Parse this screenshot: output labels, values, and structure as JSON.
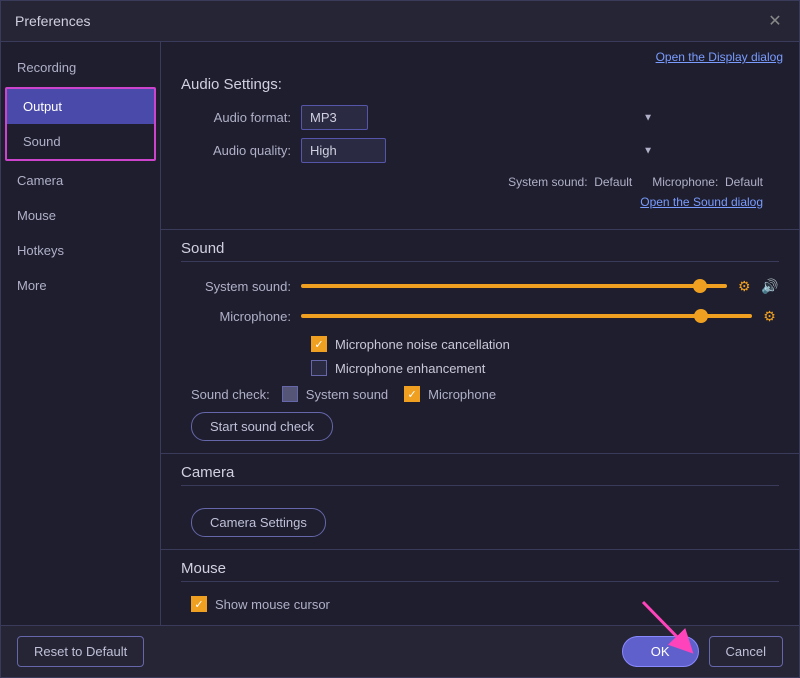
{
  "window": {
    "title": "Preferences",
    "close_label": "✕"
  },
  "sidebar": {
    "items": [
      {
        "id": "recording",
        "label": "Recording",
        "active": false,
        "outlined": false
      },
      {
        "id": "output",
        "label": "Output",
        "active": true,
        "outlined": true
      },
      {
        "id": "sound",
        "label": "Sound",
        "active": false,
        "outlined": true
      },
      {
        "id": "camera",
        "label": "Camera",
        "active": false,
        "outlined": false
      },
      {
        "id": "mouse",
        "label": "Mouse",
        "active": false,
        "outlined": false
      },
      {
        "id": "hotkeys",
        "label": "Hotkeys",
        "active": false,
        "outlined": false
      },
      {
        "id": "more",
        "label": "More",
        "active": false,
        "outlined": false
      }
    ]
  },
  "top_link": "Open the Display dialog",
  "audio_settings": {
    "title": "Audio Settings:",
    "format_label": "Audio format:",
    "format_value": "MP3",
    "quality_label": "Audio quality:",
    "quality_value": "High",
    "system_sound_label": "System sound:",
    "system_sound_value": "Default",
    "microphone_label": "Microphone:",
    "microphone_value": "Default",
    "open_sound_link": "Open the Sound dialog"
  },
  "sound_section": {
    "title": "Sound",
    "system_sound_label": "System sound:",
    "microphone_label": "Microphone:",
    "noise_cancellation_label": "Microphone noise cancellation",
    "enhancement_label": "Microphone enhancement",
    "noise_cancellation_checked": true,
    "enhancement_checked": false,
    "sound_check_label": "Sound check:",
    "system_sound_check_checked": false,
    "microphone_check_checked": true,
    "system_sound_check_label": "System sound",
    "microphone_check_label": "Microphone",
    "start_check_btn": "Start sound check"
  },
  "camera_section": {
    "title": "Camera",
    "settings_btn": "Camera Settings"
  },
  "mouse_section": {
    "title": "Mouse",
    "show_cursor_label": "Show mouse cursor"
  },
  "bottom": {
    "reset_label": "Reset to Default",
    "ok_label": "OK",
    "cancel_label": "Cancel"
  }
}
